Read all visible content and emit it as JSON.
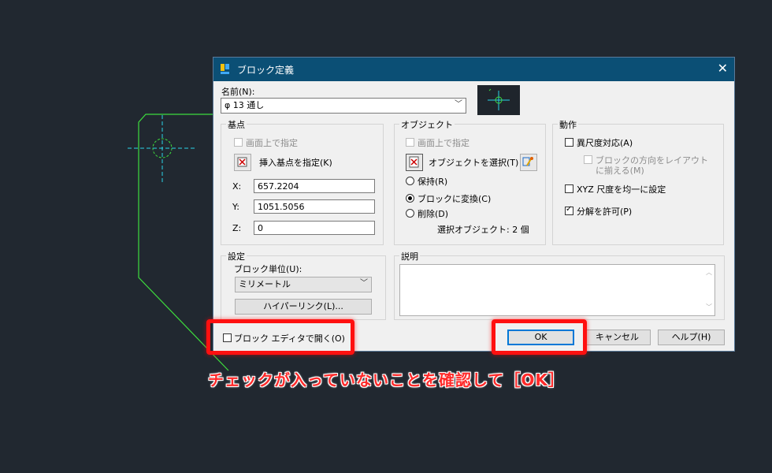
{
  "dialog": {
    "title": "ブロック定義",
    "name_label": "名前(N):",
    "name_value": "φ 13 通し"
  },
  "basepoint": {
    "title": "基点",
    "onscreen_label": "画面上で指定",
    "pick_label": "挿入基点を指定(K)",
    "x_label": "X:",
    "x_value": "657.2204",
    "y_label": "Y:",
    "y_value": "1051.5056",
    "z_label": "Z:",
    "z_value": "0"
  },
  "objects": {
    "title": "オブジェクト",
    "onscreen_label": "画面上で指定",
    "select_label": "オブジェクトを選択(T)",
    "retain_label": "保持(R)",
    "convert_label": "ブロックに変換(C)",
    "delete_label": "削除(D)",
    "selected_count": "選択オブジェクト: 2 個"
  },
  "behavior": {
    "title": "動作",
    "annotative_label": "異尺度対応(A)",
    "match_layout_label_1": "ブロックの方向をレイアウト",
    "match_layout_label_2": "に揃える(M)",
    "uniform_label": "XYZ 尺度を均一に設定",
    "explode_label": "分解を許可(P)"
  },
  "settings": {
    "title": "設定",
    "unit_label": "ブロック単位(U):",
    "unit_value": "ミリメートル",
    "hyperlink_label": "ハイパーリンク(L)..."
  },
  "description": {
    "title": "説明"
  },
  "footer": {
    "open_editor_label": "ブロック エディタで開く(O)",
    "ok_label": "OK",
    "cancel_label": "キャンセル",
    "help_label": "ヘルプ(H)"
  },
  "annotation": {
    "text": "チェックが入っていないことを確認して［OK］"
  },
  "colors": {
    "canvas_bg": "#212830",
    "drawing_line": "#3ddc3d",
    "center_line": "#2ad4e8",
    "titlebar": "#0b4f75",
    "highlight": "#ff1010"
  }
}
